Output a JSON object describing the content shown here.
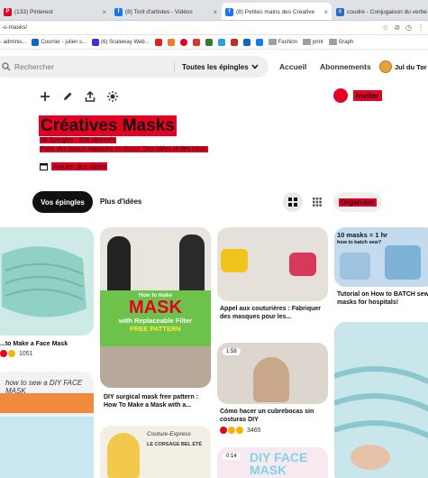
{
  "browser": {
    "tabs": [
      {
        "label": "(133) Pinterest",
        "color": "#e60023",
        "active": false
      },
      {
        "label": "(8) Toril d'artistes - Vidéos",
        "color": "#1877f2",
        "active": false
      },
      {
        "label": "(8) Petites mains des Créative",
        "color": "#1877f2",
        "active": true
      },
      {
        "label": "coudre - Conjugaison du verbe",
        "color": "#2a6ebb",
        "active": false
      }
    ],
    "url": "-s-masks/",
    "bookmarks": [
      "- adminis...",
      "Courrier - julien s...",
      "(6) Scaleway Web...",
      "Fashion",
      "print",
      "Graph"
    ]
  },
  "header": {
    "search_placeholder": "Rechercher",
    "filter_label": "Toutes les épingles",
    "nav": [
      "Accueil",
      "Abonnements"
    ],
    "user_name": "Jul du Tor"
  },
  "board": {
    "invite_label": "Inviter",
    "title": "Créatives Masks",
    "stats": "38 Épingles · 838 abonnés",
    "description": "Faire des beaux masques en tissus. Des idées et des tutos.",
    "add_dates_label": "Ajouter des dates",
    "tab_pins": "Vos épingles",
    "tab_ideas": "Plus d'idées",
    "organise_label": "Organiser"
  },
  "pins": [
    {
      "title": "...to Make a Face Mask",
      "count": "1051"
    },
    {
      "title": "How to make MASK with Replaceable Filter FREE PATTERN",
      "overlay": true
    },
    {
      "title": "DIY surgical mask free pattern : How To Make a Mask with a..."
    },
    {
      "title": "Appel aux couturières : Fabriquer des masques pour les..."
    },
    {
      "title": "Cómo hacer un cubrebocas sin costuras DIY",
      "count": "3465",
      "duration": "1:58"
    },
    {
      "title": "Tutorial on How to BATCH sew masks for hospitals!",
      "overlay_text": "10 masks = 1 hr",
      "overlay_sub": "how to batch sew?"
    },
    {
      "title": "how to sew a DIY FACE MASK"
    },
    {
      "overlay_text": "Couture-Express",
      "overlay_sub": "LE CORSAGE BEL ÉTÉ"
    },
    {
      "overlay_text": "DIY FACE MASK",
      "duration": "0:14"
    },
    {}
  ],
  "colors": {
    "brand": "#e60023",
    "pin_mask_teal": "#a5dcd3",
    "green_banner": "#6cc24a"
  }
}
